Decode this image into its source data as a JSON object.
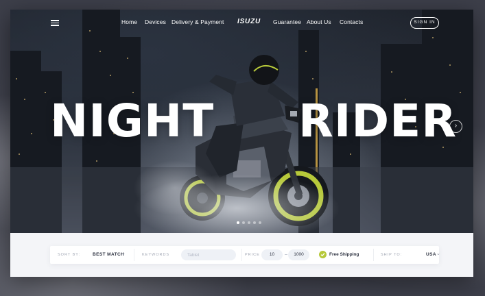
{
  "nav": {
    "menu_icon": "hamburger-menu-icon",
    "links": [
      "Home",
      "Devices",
      "Delivery & Payment",
      "Guarantee",
      "About Us",
      "Contacts"
    ],
    "logo": "ISUZU",
    "signin_label": "SIGN IN"
  },
  "hero": {
    "title_left": "NIGHT",
    "title_right": "RIDER",
    "next_icon": "chevron-right-icon",
    "slide_count": 5,
    "active_slide": 1
  },
  "filters": {
    "sort_by": {
      "label": "SORT BY:",
      "value": "BEST MATCH"
    },
    "keywords": {
      "label": "KEYWORDS",
      "placeholder": "Tablet"
    },
    "price": {
      "label": "PRICE",
      "min": "10",
      "max": "1000"
    },
    "free_shipping": {
      "label": "Free Shipping",
      "checked": true
    },
    "ship_to": {
      "label": "SHIP TO:",
      "value": "USA"
    }
  },
  "colors": {
    "accent": "#b7c93a",
    "hero_dark": "#1f242d",
    "text_dark": "#2d3240",
    "muted": "#a3a8b5"
  }
}
